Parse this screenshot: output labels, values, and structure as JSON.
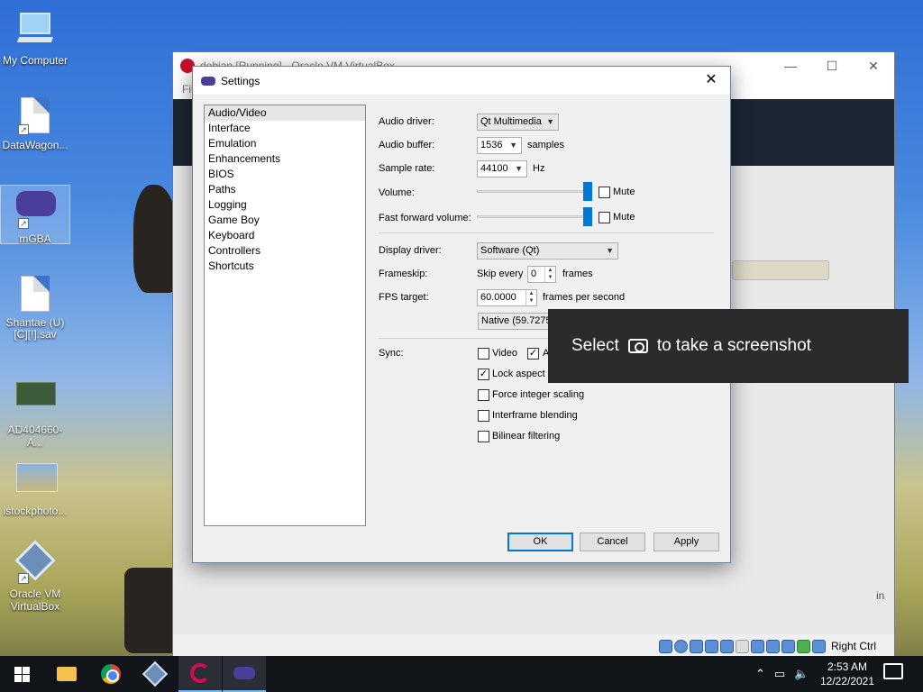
{
  "desktop": {
    "icons": [
      {
        "label": "My Computer",
        "icon": "computer-icon"
      },
      {
        "label": "DataWagon...",
        "icon": "document-icon"
      },
      {
        "label": "mGBA",
        "icon": "gba-icon"
      },
      {
        "label": "Shantae (U) [C][!].sav",
        "icon": "document-icon"
      },
      {
        "label": "AD404660- A...",
        "icon": "image-icon"
      },
      {
        "label": "istockphoto...",
        "icon": "image-icon"
      },
      {
        "label": "Oracle VM VirtualBox",
        "icon": "virtualbox-icon"
      }
    ]
  },
  "vbox_window": {
    "title": "debian [Running] - Oracle VM VirtualBox",
    "menu_first": "File",
    "status_right": "Right Ctrl",
    "side_text": "in"
  },
  "settings": {
    "title": "Settings",
    "categories": [
      "Audio/Video",
      "Interface",
      "Emulation",
      "Enhancements",
      "BIOS",
      "Paths",
      "Logging",
      "Game Boy",
      "Keyboard",
      "Controllers",
      "Shortcuts"
    ],
    "selected_category": "Audio/Video",
    "audio_driver": {
      "label": "Audio driver:",
      "value": "Qt Multimedia"
    },
    "audio_buffer": {
      "label": "Audio buffer:",
      "value": "1536",
      "unit": "samples"
    },
    "sample_rate": {
      "label": "Sample rate:",
      "value": "44100",
      "unit": "Hz"
    },
    "volume": {
      "label": "Volume:",
      "level": 1.0,
      "mute_label": "Mute",
      "muted": false
    },
    "ff_volume": {
      "label": "Fast forward volume:",
      "level": 1.0,
      "mute_label": "Mute",
      "muted": false
    },
    "display_driver": {
      "label": "Display driver:",
      "value": "Software (Qt)"
    },
    "frameskip": {
      "label": "Frameskip:",
      "prefix": "Skip every",
      "value": "0",
      "unit": "frames"
    },
    "fps_target": {
      "label": "FPS target:",
      "value": "60.0000",
      "unit": "frames per second"
    },
    "native_button": "Native (59.7275)",
    "sync": {
      "label": "Sync:",
      "video_label": "Video",
      "video_checked": false,
      "audio_label": "Audio",
      "audio_checked": true
    },
    "lock_aspect": {
      "label": "Lock aspect ratio",
      "checked": true
    },
    "force_integer": {
      "label": "Force integer scaling",
      "checked": false
    },
    "interframe": {
      "label": "Interframe blending",
      "checked": false
    },
    "bilinear": {
      "label": "Bilinear filtering",
      "checked": false
    },
    "buttons": {
      "ok": "OK",
      "cancel": "Cancel",
      "apply": "Apply"
    }
  },
  "snip_tooltip": {
    "before": "Select",
    "after": "to take a screenshot"
  },
  "taskbar": {
    "time": "2:53 AM",
    "date": "12/22/2021"
  }
}
